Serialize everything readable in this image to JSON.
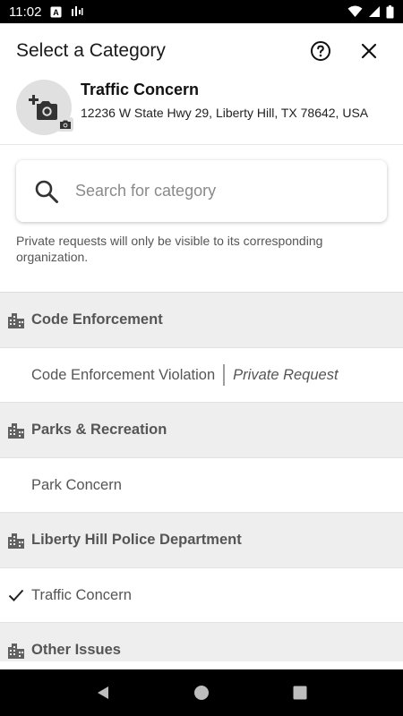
{
  "status_bar": {
    "time": "11:02"
  },
  "header": {
    "title": "Select a Category"
  },
  "selected": {
    "title": "Traffic Concern",
    "address": "12236 W State Hwy 29, Liberty Hill, TX 78642, USA"
  },
  "search": {
    "placeholder": "Search for category",
    "value": ""
  },
  "privacy_note": "Private requests will only be visible to its corresponding organization.",
  "groups": [
    {
      "label": "Code Enforcement",
      "items": [
        {
          "label": "Code Enforcement Violation",
          "tag": "Private Request",
          "checked": false
        }
      ]
    },
    {
      "label": "Parks & Recreation",
      "items": [
        {
          "label": "Park Concern",
          "tag": "",
          "checked": false
        }
      ]
    },
    {
      "label": "Liberty Hill Police Department",
      "items": [
        {
          "label": "Traffic Concern",
          "tag": "",
          "checked": true
        }
      ]
    },
    {
      "label": "Other Issues",
      "items": []
    }
  ],
  "colors": {
    "group_bg": "#eeeeee",
    "text_muted": "#555555",
    "avatar_bg": "#e0e0e0"
  }
}
